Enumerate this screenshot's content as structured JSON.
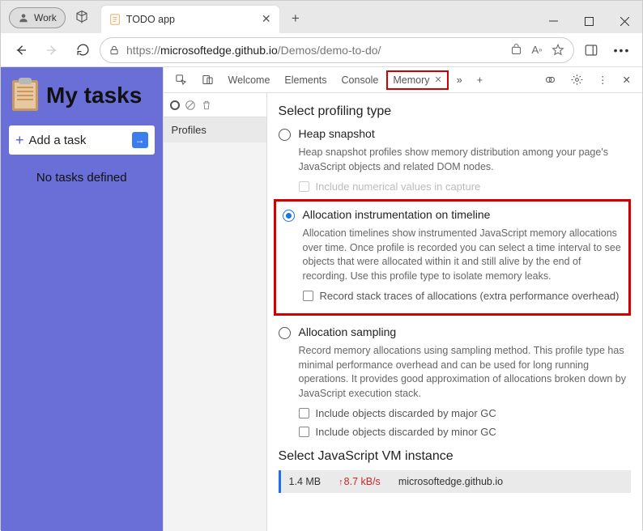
{
  "titlebar": {
    "work_label": "Work",
    "tab_title": "TODO app"
  },
  "address": {
    "scheme_host": "https://microsoftedge.github.io",
    "path": "/Demos/demo-to-do/"
  },
  "app": {
    "title": "My tasks",
    "add_task_label": "Add a task",
    "empty_label": "No tasks defined"
  },
  "devtools": {
    "tabs": {
      "welcome": "Welcome",
      "elements": "Elements",
      "console": "Console",
      "memory": "Memory"
    },
    "sidebar_label": "Profiles",
    "section_title": "Select profiling type",
    "options": {
      "heap": {
        "label": "Heap snapshot",
        "desc": "Heap snapshot profiles show memory distribution among your page's JavaScript objects and related DOM nodes.",
        "chk1": "Include numerical values in capture"
      },
      "timeline": {
        "label": "Allocation instrumentation on timeline",
        "desc": "Allocation timelines show instrumented JavaScript memory allocations over time. Once profile is recorded you can select a time interval to see objects that were allocated within it and still alive by the end of recording. Use this profile type to isolate memory leaks.",
        "chk1": "Record stack traces of allocations (extra performance overhead)"
      },
      "sampling": {
        "label": "Allocation sampling",
        "desc": "Record memory allocations using sampling method. This profile type has minimal performance overhead and can be used for long running operations. It provides good approximation of allocations broken down by JavaScript execution stack.",
        "chk1": "Include objects discarded by major GC",
        "chk2": "Include objects discarded by minor GC"
      }
    },
    "vm": {
      "title": "Select JavaScript VM instance",
      "size": "1.4 MB",
      "rate": "8.7 kB/s",
      "instance": "microsoftedge.github.io"
    }
  }
}
